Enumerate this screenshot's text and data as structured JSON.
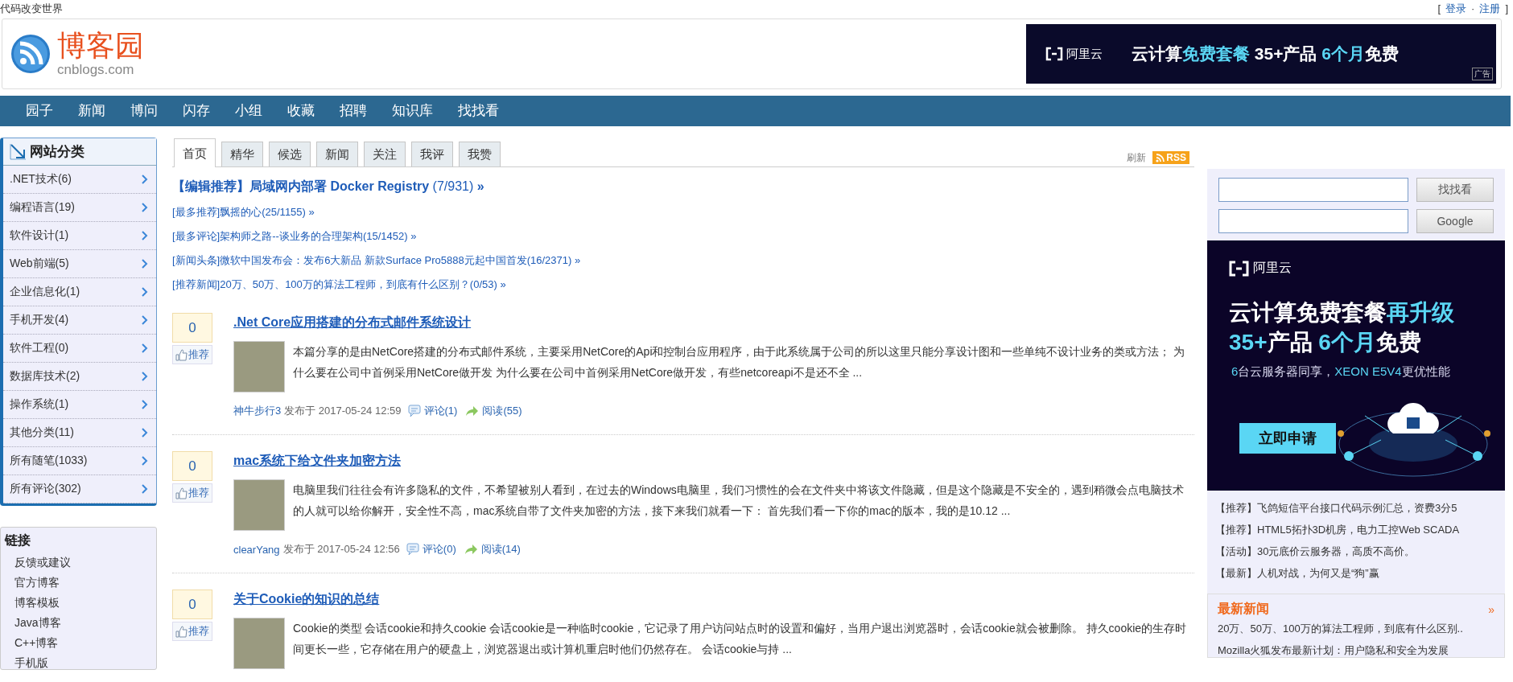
{
  "top_bar": {
    "slogan": "代码改变世界",
    "open": "[",
    "links": [
      {
        "label": "登录"
      },
      {
        "label": "注册"
      }
    ],
    "separator": "·",
    "close": "]"
  },
  "logo": {
    "name": "博客园",
    "domain": "cnblogs.com"
  },
  "header_ad": {
    "brand": "阿里云",
    "segments": [
      {
        "text": "云计算",
        "highlight": false
      },
      {
        "text": "免费套餐",
        "highlight": true
      },
      {
        "text": " 35+产品 ",
        "highlight": false
      },
      {
        "text": "6个月",
        "highlight": true
      },
      {
        "text": "免费",
        "highlight": false
      }
    ],
    "tag": "广告"
  },
  "nav": [
    "园子",
    "新闻",
    "博问",
    "闪存",
    "小组",
    "收藏",
    "招聘",
    "知识库",
    "找找看"
  ],
  "categories": {
    "title": "网站分类",
    "items": [
      ".NET技术(6)",
      "编程语言(19)",
      "软件设计(1)",
      "Web前端(5)",
      "企业信息化(1)",
      "手机开发(4)",
      "软件工程(0)",
      "数据库技术(2)",
      "操作系统(1)",
      "其他分类(11)",
      "所有随笔(1033)",
      "所有评论(302)"
    ]
  },
  "links_box": {
    "title": "链接",
    "items": [
      "反馈或建议",
      "官方博客",
      "博客模板",
      "Java博客",
      "C++博客",
      "手机版"
    ]
  },
  "tabs": [
    {
      "label": "首页",
      "selected": true
    },
    {
      "label": "精华",
      "selected": false
    },
    {
      "label": "候选",
      "selected": false
    },
    {
      "label": "新闻",
      "selected": false
    },
    {
      "label": "关注",
      "selected": false
    },
    {
      "label": "我评",
      "selected": false
    },
    {
      "label": "我赞",
      "selected": false
    }
  ],
  "refresh": "刷新",
  "rss": "RSS",
  "headline": {
    "text": "【编辑推荐】局域网内部署 Docker Registry",
    "count": "(7/931)",
    "arrow": "»"
  },
  "featured": [
    "[最多推荐]飘摇的心(25/1155) »",
    "[最多评论]架构师之路--谈业务的合理架构(15/1452) »",
    "[新闻头条]微软中国发布会：发布6大新品 新款Surface Pro5888元起中国首发(16/2371) »",
    "[推荐新闻]20万、50万、100万的算法工程师，到底有什么区别？(0/53) »"
  ],
  "posts": [
    {
      "votes": "0",
      "recommend": "推荐",
      "title": ".Net Core应用搭建的分布式邮件系统设计",
      "summary": "本篇分享的是由NetCore搭建的分布式邮件系统，主要采用NetCore的Api和控制台应用程序，由于此系统属于公司的所以这里只能分享设计图和一些单纯不设计业务的类或方法； 为什么要在公司中首例采用NetCore做开发 为什么要在公司中首例采用NetCore做开发，有些netcoreapi不是还不全 ...",
      "author": "神牛步行3",
      "posted": "发布于 2017-05-24 12:59",
      "comments": "评论(1)",
      "reads": "阅读(55)"
    },
    {
      "votes": "0",
      "recommend": "推荐",
      "title": "mac系统下给文件夹加密方法",
      "summary": "电脑里我们往往会有许多隐私的文件，不希望被别人看到，在过去的Windows电脑里，我们习惯性的会在文件夹中将该文件隐藏，但是这个隐藏是不安全的，遇到稍微会点电脑技术的人就可以给你解开，安全性不高，mac系统自带了文件夹加密的方法，接下来我们就看一下： 首先我们看一下你的mac的版本，我的是10.12 ...",
      "author": "clearYang",
      "posted": "发布于 2017-05-24 12:56",
      "comments": "评论(0)",
      "reads": "阅读(14)"
    },
    {
      "votes": "0",
      "recommend": "推荐",
      "title": "关于Cookie的知识的总结",
      "summary": "Cookie的类型 会话cookie和持久cookie 会话cookie是一种临时cookie，它记录了用户访问站点时的设置和偏好，当用户退出浏览器时，会话cookie就会被删除。 持久cookie的生存时间更长一些，它存储在用户的硬盘上，浏览器退出或计算机重启时他们仍然存在。 会话cookie与持 ..."
    }
  ],
  "search": {
    "buttons": [
      "找找看",
      "Google"
    ]
  },
  "side_ad": {
    "brand": "阿里云",
    "lines": [
      [
        {
          "text": "云计算免费套餐",
          "highlight": false
        },
        {
          "text": "再升级",
          "highlight": true
        }
      ],
      [
        {
          "text": "35+",
          "highlight": true
        },
        {
          "text": "产品 ",
          "highlight": false
        },
        {
          "text": "6个月",
          "highlight": true
        },
        {
          "text": "免费",
          "highlight": false
        }
      ]
    ],
    "subline": [
      {
        "text": "6",
        "highlight": true
      },
      {
        "text": "台云服务器同享，",
        "highlight": false
      },
      {
        "text": "XEON E5V4",
        "highlight": true
      },
      {
        "text": "更优性能",
        "highlight": false
      }
    ],
    "button": "立即申请"
  },
  "ad_links": [
    "【推荐】飞鸽短信平台接口代码示例汇总，资费3分5",
    "【推荐】HTML5拓扑3D机房，电力工控Web SCADA",
    "【活动】30元底价云服务器，高质不高价。",
    "【最新】人机对战，为何又是“狗”赢"
  ],
  "latest_news": {
    "title": "最新新闻",
    "more": "»",
    "items": [
      "20万、50万、100万的算法工程师，到底有什么区别..",
      "Mozilla火狐发布最新计划：用户隐私和安全为发展"
    ]
  }
}
